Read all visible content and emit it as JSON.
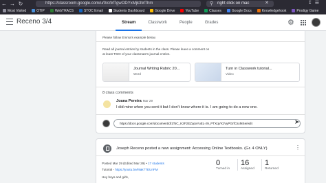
{
  "browser": {
    "url": "https://classroom.google.com/u/0/c/MTgwODYxMjk3MThm",
    "search_query": "right click on mac",
    "bookmarks": [
      {
        "label": "Most Visited",
        "color": "#8f8f9d"
      },
      {
        "label": "OTIP",
        "color": "#4a90d9"
      },
      {
        "label": "WebTRACS",
        "color": "#2e7d32"
      },
      {
        "label": "STOC Email",
        "color": "#1565c0"
      },
      {
        "label": "Students Dashboard",
        "color": "#ffffff"
      },
      {
        "label": "Google Drive",
        "color": "#fbbc04"
      },
      {
        "label": "YouTube",
        "color": "#ff0000"
      },
      {
        "label": "Classes",
        "color": "#0f9d58"
      },
      {
        "label": "Google Docs",
        "color": "#4285f4"
      },
      {
        "label": "Knowledgehook",
        "color": "#e8710a"
      },
      {
        "label": "Prodigy Game",
        "color": "#7e57c2"
      }
    ]
  },
  "header": {
    "title": "Receno 3/4",
    "tabs": [
      {
        "label": "Stream",
        "active": true
      },
      {
        "label": "Classwork",
        "active": false
      },
      {
        "label": "People",
        "active": false
      },
      {
        "label": "Grades",
        "active": false
      }
    ]
  },
  "post1": {
    "line1": "Please follow Emma's example below.",
    "line2": "Read all journal entries by students in the class. Please leave a comment on",
    "line3": "at least TWO of your classmate's journal entries.",
    "attachments": [
      {
        "title": "Journal Writing Rubric 20...",
        "type": "Word"
      },
      {
        "title": "Turn in Classwork tutorial...",
        "type": "Video"
      }
    ],
    "comments_count": "8 class comments",
    "comment": {
      "author": "Joana Pereira",
      "date": "Mar 29",
      "text": "I did mine when you sent it but I don't know where it is. I am going to do a new one."
    },
    "comment_input": "https://docs.google.com/document/d/1TsC_K2F2EZqoxYuEL-z9_PTXqVXzVyPGrfCsxMSe/edit"
  },
  "post2": {
    "title": "Joseph Receno posted a new assignment: Accessing Online Textbooks. (Gr. 4 ONLY)",
    "posted": "Posted Mar 29 (Edited Mar 29)",
    "students": "17 students",
    "tutorial_label": "Tutorial - ",
    "tutorial_link": "https://youtu.be/I9ak7TEUnFM",
    "greeting": "Hey boys and girls,",
    "stats": [
      {
        "value": "0",
        "label": "Turned in"
      },
      {
        "value": "16",
        "label": "Assigned"
      },
      {
        "value": "1",
        "label": "Returned"
      }
    ]
  }
}
